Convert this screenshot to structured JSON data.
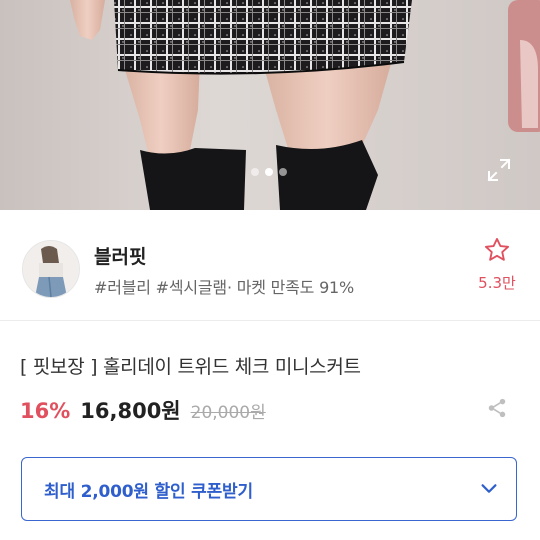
{
  "shop": {
    "name": "블러핏",
    "tags": "#러블리 #섹시글램· 마켓 만족도 91%",
    "like_count": "5.3만"
  },
  "product": {
    "title": "[ 핏보장 ] 홀리데이 트위드 체크 미니스커트",
    "discount": "16%",
    "price": "16,800원",
    "original_price": "20,000원"
  },
  "coupon": {
    "label": "최대 2,000원 할인 쿠폰받기"
  },
  "gallery": {
    "image_count": 3,
    "active_index": 1
  },
  "colors": {
    "accent_red": "#e0505e",
    "accent_blue": "#2f5fcc"
  },
  "icons": {
    "fullscreen": "expand-arrows-icon",
    "like": "star-outline-icon",
    "share": "share-icon",
    "coupon_toggle": "chevron-down-icon"
  }
}
